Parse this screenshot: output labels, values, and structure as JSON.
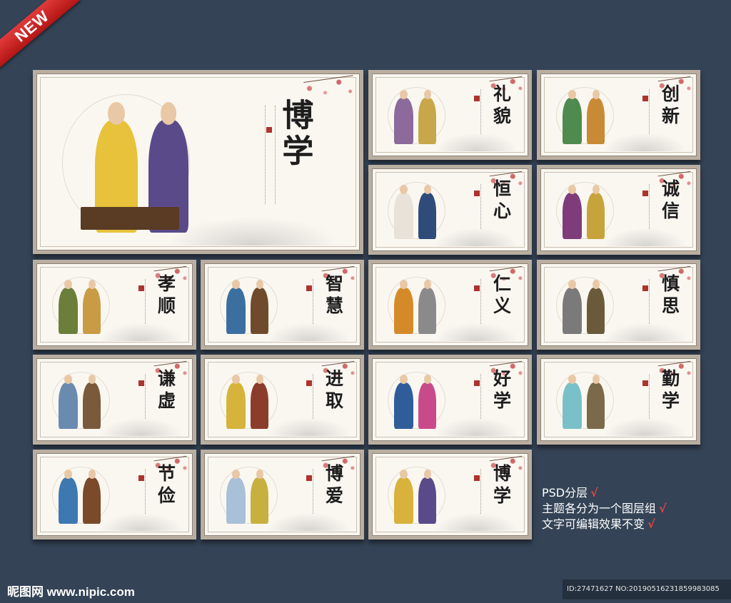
{
  "ribbon": {
    "label": "NEW"
  },
  "main_panel": {
    "title": "博学"
  },
  "panels": [
    {
      "title": "礼貌",
      "colors": [
        "#8c6a9c",
        "#c8a64a"
      ]
    },
    {
      "title": "创新",
      "colors": [
        "#4f8a4e",
        "#c98a35"
      ]
    },
    {
      "title": "恒心",
      "colors": [
        "#e8e2d8",
        "#2f4b7a"
      ]
    },
    {
      "title": "诚信",
      "colors": [
        "#7e3c7a",
        "#c6a43b"
      ]
    },
    {
      "title": "孝顺",
      "colors": [
        "#6b7e3a",
        "#c99b45"
      ]
    },
    {
      "title": "智慧",
      "colors": [
        "#3b6fa0",
        "#6f4b2c"
      ]
    },
    {
      "title": "仁义",
      "colors": [
        "#d58a2a",
        "#8a8a8a"
      ]
    },
    {
      "title": "慎思",
      "colors": [
        "#7a7a7a",
        "#6b5a3a"
      ]
    },
    {
      "title": "谦虚",
      "colors": [
        "#6a8ab0",
        "#7a5a3a"
      ]
    },
    {
      "title": "进取",
      "colors": [
        "#d6b33a",
        "#8b3c2a"
      ]
    },
    {
      "title": "好学",
      "colors": [
        "#2e5d9a",
        "#c84a8a"
      ]
    },
    {
      "title": "勤学",
      "colors": [
        "#7ac0c8",
        "#7a6a4a"
      ]
    },
    {
      "title": "节俭",
      "colors": [
        "#3d78b0",
        "#7a4a2a"
      ]
    },
    {
      "title": "博爱",
      "colors": [
        "#a8c0d8",
        "#c8b040"
      ]
    },
    {
      "title": "博学",
      "colors": [
        "#d8b23a",
        "#5a4a8a"
      ]
    }
  ],
  "notes": {
    "line1": "PSD分层",
    "line2": "主题各分为一个图层组",
    "line3": "文字可编辑效果不变",
    "check": "√"
  },
  "footer": {
    "logo": "昵图网 www.nipic.com",
    "id_text": "ID:27471627 NO:20190516231859983085"
  }
}
